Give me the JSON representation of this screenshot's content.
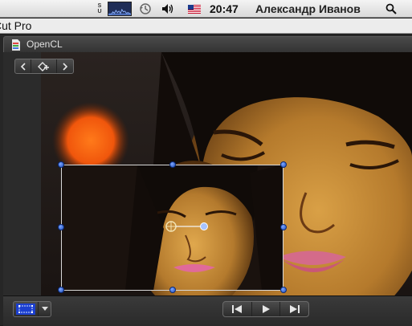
{
  "menubar": {
    "su_top": "S",
    "su_bottom": "U",
    "icons": [
      "activity-graph-icon",
      "time-machine-icon",
      "volume-icon",
      "us-flag-icon",
      "spotlight-search-icon"
    ],
    "time": "20:47",
    "user": "Александр Иванов"
  },
  "app": {
    "title": "Cut Pro"
  },
  "viewer": {
    "tab_label": "OpenCL",
    "nav": {
      "prev_icon": "chevron-left-icon",
      "keyframe_icon": "add-keyframe-icon",
      "next_icon": "chevron-right-icon"
    },
    "bottombar": {
      "view_mode_icon": "transform-view-icon",
      "transport": [
        "skip-to-start-icon",
        "play-icon",
        "skip-to-end-icon"
      ]
    }
  },
  "colors": {
    "handle_blue": "#2f63d8",
    "highlight_blue": "#1c3fcf"
  }
}
